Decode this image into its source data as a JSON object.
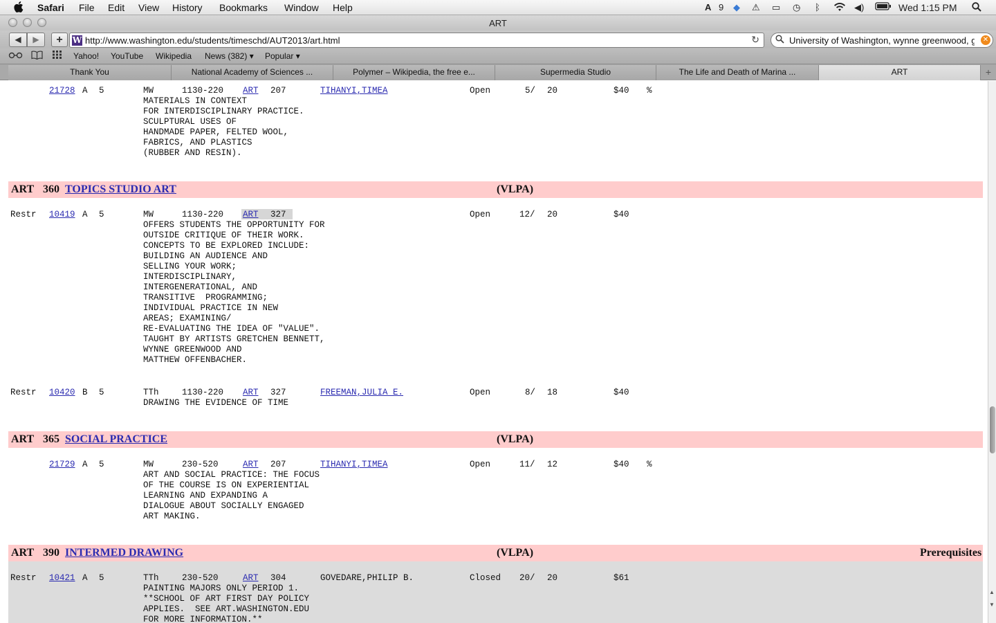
{
  "menubar": {
    "apple": "",
    "app": "Safari",
    "items": [
      "File",
      "Edit",
      "View",
      "History",
      "Bookmarks",
      "Window",
      "Help"
    ],
    "status_count": "9",
    "clock": "Wed 1:15 PM"
  },
  "window": {
    "title": "ART"
  },
  "toolbar": {
    "back": "◀",
    "forward": "▶",
    "add": "+",
    "favicon": "W",
    "url": "http://www.washington.edu/students/timeschd/AUT2013/art.html",
    "reload": "↻",
    "search_value": "University of Washington, wynne greenwood, gr"
  },
  "bookmarks": [
    "Yahoo!",
    "YouTube",
    "Wikipedia",
    "News (382) ▾",
    "Popular ▾"
  ],
  "tabs": [
    "Thank You",
    "National Academy of Sciences ...",
    "Polymer – Wikipedia, the free e...",
    "Supermedia Studio",
    "The Life and Death of Marina ...",
    "ART"
  ],
  "sections": [
    {
      "rows": [
        {
          "restr": "",
          "sln": "21728",
          "section": "A",
          "credits": "5",
          "days": "MW",
          "time": "1130-220",
          "bldg": "ART",
          "room": "207",
          "instructor": "TIHANYI,TIMEA",
          "status": "Open",
          "enrl": "5/",
          "limit": "20",
          "fee": "$40",
          "other": "%",
          "desc": "MATERIALS IN CONTEXT\nFOR INTERDISCIPLINARY PRACTICE.\nSCULPTURAL USES OF\nHANDMADE PAPER, FELTED WOOL,\nFABRICS, AND PLASTICS\n(RUBBER AND RESIN)."
        }
      ]
    },
    {
      "header": {
        "dept": "ART",
        "num": "360",
        "title": "TOPICS STUDIO ART",
        "gen_ed": "(VLPA)",
        "prereq": ""
      },
      "rows": [
        {
          "restr": "Restr",
          "sln": "10419",
          "section": "A",
          "credits": "5",
          "days": "MW",
          "time": "1130-220",
          "bldg": "ART",
          "room": "327",
          "instructor": "",
          "status": "Open",
          "enrl": "12/",
          "limit": "20",
          "fee": "$40",
          "other": "",
          "desc": "OFFERS STUDENTS THE OPPORTUNITY FOR\nOUTSIDE CRITIQUE OF THEIR WORK.\nCONCEPTS TO BE EXPLORED INCLUDE:\nBUILDING AN AUDIENCE AND\nSELLING YOUR WORK;\nINTERDISCIPLINARY,\nINTERGENERATIONAL, AND\nTRANSITIVE  PROGRAMMING;\nINDIVIDUAL PRACTICE IN NEW\nAREAS; EXAMINING/\nRE-EVALUATING THE IDEA OF \"VALUE\".\nTAUGHT BY ARTISTS GRETCHEN BENNETT,\nWYNNE GREENWOOD AND\nMATTHEW OFFENBACHER."
        },
        {
          "restr": "Restr",
          "sln": "10420",
          "section": "B",
          "credits": "5",
          "days": "TTh",
          "time": "1130-220",
          "bldg": "ART",
          "room": "327",
          "instructor": "FREEMAN,JULIA E.",
          "status": "Open",
          "enrl": "8/",
          "limit": "18",
          "fee": "$40",
          "other": "",
          "desc": "DRAWING THE EVIDENCE OF TIME"
        }
      ]
    },
    {
      "header": {
        "dept": "ART",
        "num": "365",
        "title": "SOCIAL PRACTICE",
        "gen_ed": "(VLPA)",
        "prereq": ""
      },
      "rows": [
        {
          "restr": "",
          "sln": "21729",
          "section": "A",
          "credits": "5",
          "days": "MW",
          "time": "230-520",
          "bldg": "ART",
          "room": "207",
          "instructor": "TIHANYI,TIMEA",
          "status": "Open",
          "enrl": "11/",
          "limit": "12",
          "fee": "$40",
          "other": "%",
          "desc": "ART AND SOCIAL PRACTICE: THE FOCUS\nOF THE COURSE IS ON EXPERIENTIAL\nLEARNING AND EXPANDING A\nDIALOGUE ABOUT SOCIALLY ENGAGED\nART MAKING."
        }
      ]
    },
    {
      "header": {
        "dept": "ART",
        "num": "390",
        "title": "INTERMED DRAWING",
        "gen_ed": "(VLPA)",
        "prereq": "Prerequisites"
      },
      "rows": [
        {
          "restr": "Restr",
          "sln": "10421",
          "section": "A",
          "credits": "5",
          "days": "TTh",
          "time": "230-520",
          "bldg": "ART",
          "room": "304",
          "instructor": "GOVEDARE,PHILIP B.",
          "status": "Closed",
          "enrl": "20/",
          "limit": "20",
          "fee": "$61",
          "other": "",
          "desc": "PAINTING MAJORS ONLY PERIOD 1.\n**SCHOOL OF ART FIRST DAY POLICY\nAPPLIES.  SEE ART.WASHINGTON.EDU\nFOR MORE INFORMATION.**"
        }
      ]
    }
  ]
}
